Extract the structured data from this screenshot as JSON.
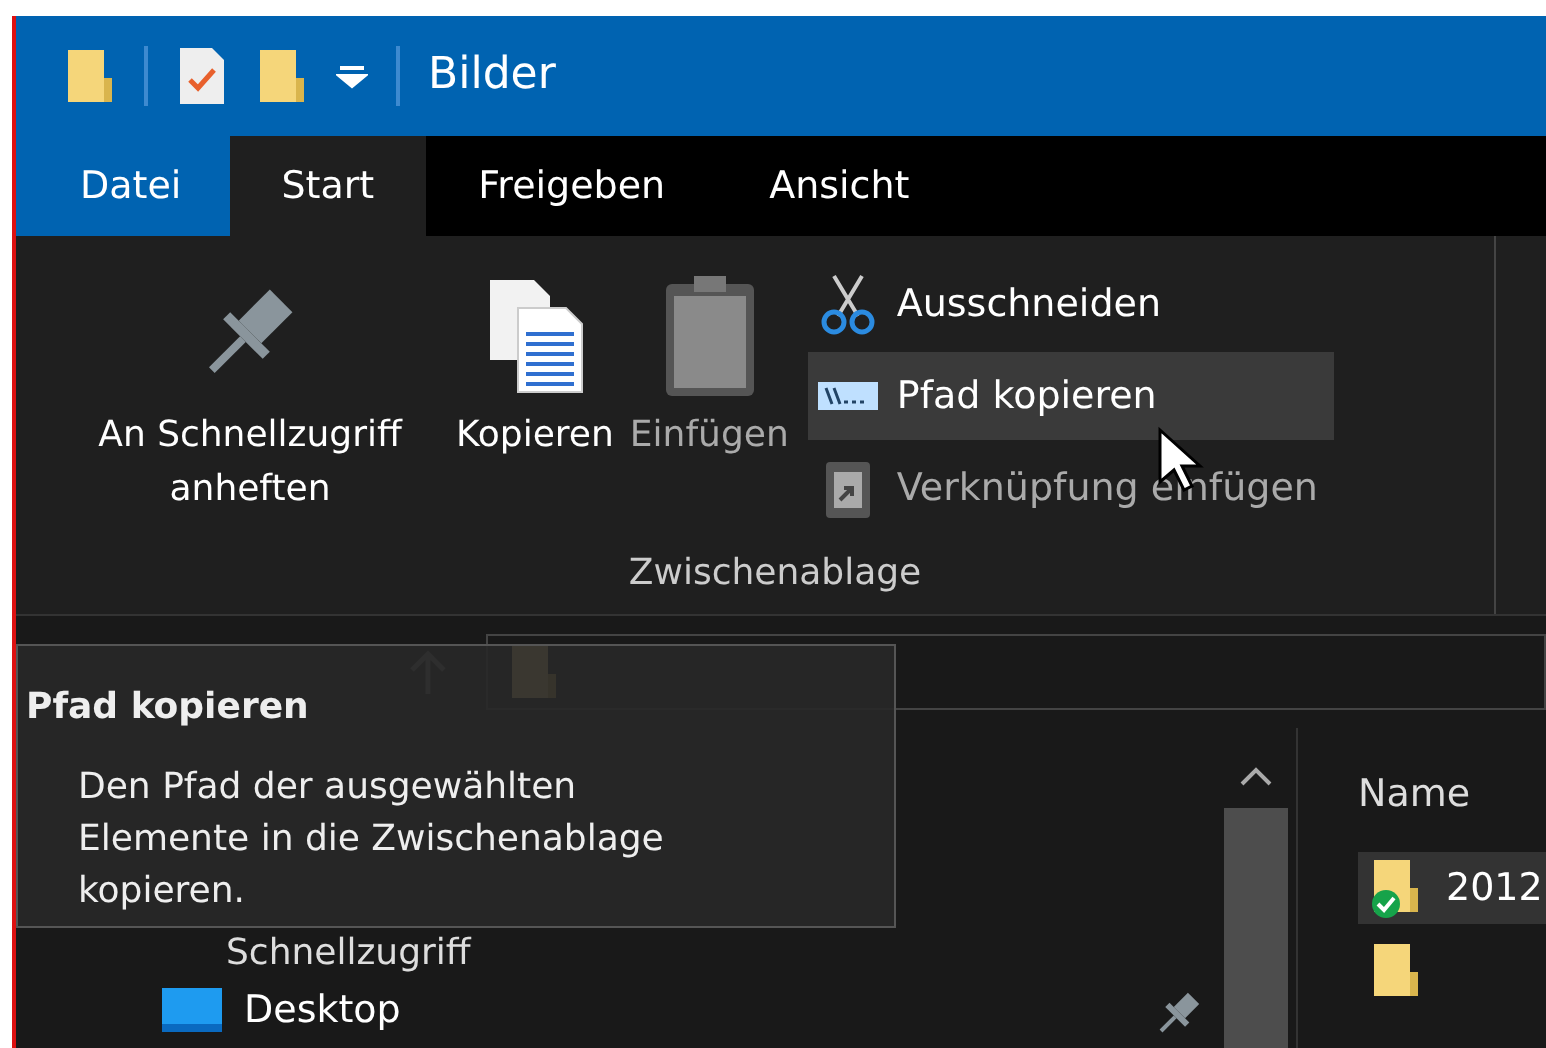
{
  "window": {
    "title": "Bilder"
  },
  "quick_access_toolbar": [
    {
      "kind": "folder"
    },
    {
      "kind": "properties"
    },
    {
      "kind": "new-folder"
    },
    {
      "kind": "customize"
    }
  ],
  "tabs": [
    {
      "label": "Datei",
      "kind": "file",
      "selected": false
    },
    {
      "label": "Start",
      "kind": "tab",
      "selected": true
    },
    {
      "label": "Freigeben",
      "kind": "tab",
      "selected": false
    },
    {
      "label": "Ansicht",
      "kind": "tab",
      "selected": false
    }
  ],
  "ribbon": {
    "group": {
      "label": "Zwischenablage",
      "large_buttons": [
        {
          "label": "An Schnellzugriff anheften",
          "kind": "pin",
          "disabled": false
        },
        {
          "label": "Kopieren",
          "kind": "copy",
          "disabled": false
        },
        {
          "label": "Einfügen",
          "kind": "paste",
          "disabled": true
        }
      ],
      "small_buttons": [
        {
          "label": "Ausschneiden",
          "kind": "cut",
          "disabled": false,
          "hovered": false
        },
        {
          "label": "Pfad kopieren",
          "kind": "path",
          "disabled": false,
          "hovered": true
        },
        {
          "label": "Verknüpfung einfügen",
          "kind": "shortcut",
          "disabled": true,
          "hovered": false
        }
      ]
    }
  },
  "tooltip": {
    "title": "Pfad kopieren",
    "text": "Den Pfad der ausgewählten Elemente in die Zwischenablage kopieren."
  },
  "navigation_pane": {
    "items": [
      {
        "label": "Schnellzugriff",
        "kind": "quick"
      },
      {
        "label": "Desktop",
        "kind": "desktop",
        "pinned": true
      }
    ]
  },
  "file_list": {
    "columns": [
      "Name"
    ],
    "rows": [
      {
        "name": "2012",
        "synced": true,
        "selected": true
      },
      {
        "synced": false,
        "selected": false
      }
    ]
  }
}
